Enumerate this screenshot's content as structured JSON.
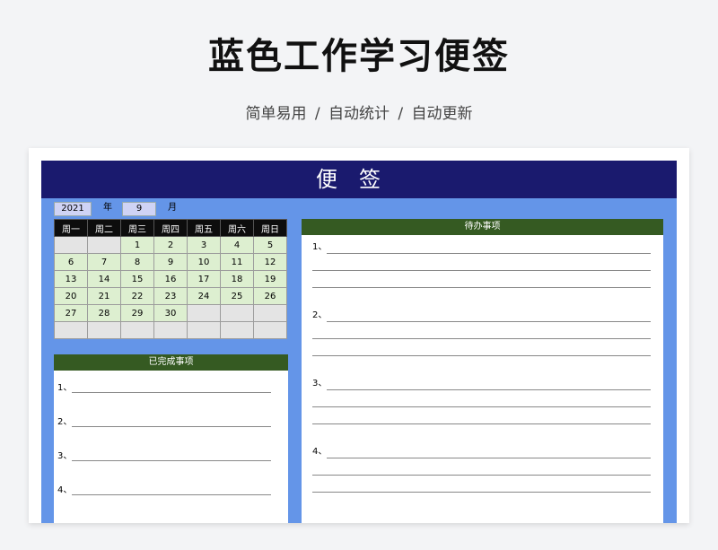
{
  "page": {
    "title": "蓝色工作学习便签",
    "subtitle": "简单易用 / 自动统计 / 自动更新"
  },
  "sheet": {
    "header": "便签",
    "year": "2021",
    "year_label": "年",
    "month": "9",
    "month_label": "月"
  },
  "calendar": {
    "weekdays": [
      "周一",
      "周二",
      "周三",
      "周四",
      "周五",
      "周六",
      "周日"
    ],
    "rows": [
      [
        "",
        "",
        "1",
        "2",
        "3",
        "4",
        "5"
      ],
      [
        "6",
        "7",
        "8",
        "9",
        "10",
        "11",
        "12"
      ],
      [
        "13",
        "14",
        "15",
        "16",
        "17",
        "18",
        "19"
      ],
      [
        "20",
        "21",
        "22",
        "23",
        "24",
        "25",
        "26"
      ],
      [
        "27",
        "28",
        "29",
        "30",
        "",
        "",
        ""
      ],
      [
        "",
        "",
        "",
        "",
        "",
        "",
        ""
      ]
    ]
  },
  "completed": {
    "title": "已完成事项",
    "items": [
      "1、",
      "2、",
      "3、",
      "4、"
    ]
  },
  "todo": {
    "title": "待办事项",
    "items": [
      "1、",
      "2、",
      "3、",
      "4、"
    ]
  },
  "colors": {
    "header_bg": "#1a1a6e",
    "sheet_bg": "#6495e8",
    "panel_head": "#355a22",
    "date_cell": "#ddefd0",
    "empty_cell": "#e4e4e4"
  }
}
